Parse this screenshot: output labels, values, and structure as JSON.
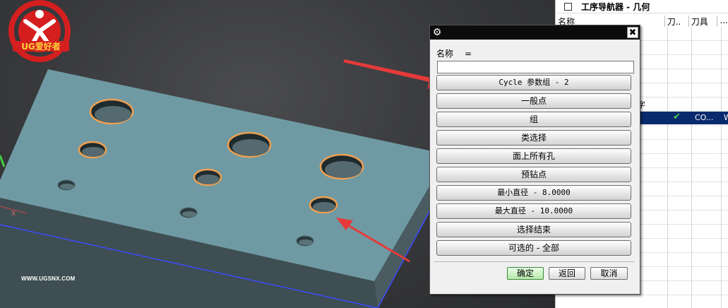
{
  "watermark": {
    "brand": "UG爱好者",
    "url": "WWW.UGSNX.COM"
  },
  "navigator": {
    "title": "工序导航器 - 几何",
    "columns": [
      "名称",
      "刀..",
      "刀具",
      "..."
    ],
    "partial_row_text": "字",
    "selected_row": {
      "check": "✔",
      "tool": "CO...",
      "last": "W"
    }
  },
  "dialog": {
    "name_label": "名称",
    "equals": "=",
    "name_value": "",
    "buttons": [
      "Cycle 参数组 - 2",
      "一般点",
      "组",
      "类选择",
      "面上所有孔",
      "预钻点",
      "最小直径 - 8.0000",
      "最大直径 - 10.0000",
      "选择结束",
      "可选的 - 全部"
    ],
    "ok_label": "确定",
    "back_label": "返回",
    "cancel_label": "取消",
    "close_glyph": "✖",
    "gear_glyph": "⚙"
  },
  "colors": {
    "plate_top": "#6f9aa3",
    "hole_highlight": "#f0a050",
    "arrow": "#e53a3a",
    "selected_row": "#0a2a6e"
  },
  "icons": [
    "gear-icon",
    "close-icon",
    "checkmark-icon",
    "window-icon"
  ]
}
